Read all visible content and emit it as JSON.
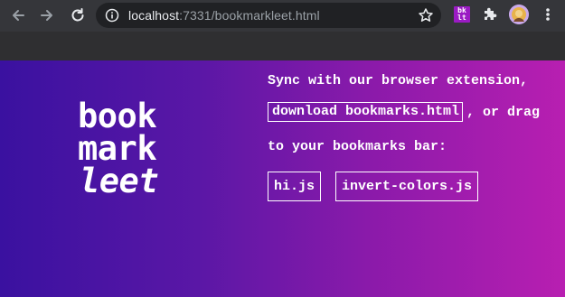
{
  "browser": {
    "url_host": "localhost",
    "url_rest": ":7331/bookmarkleet.html",
    "extension_badge_line1": "bk",
    "extension_badge_line2": "lt"
  },
  "logo": {
    "line1": "book",
    "line2": "mark",
    "line3": "leet"
  },
  "copy": {
    "line1": "Sync with our browser extension,",
    "download_link": "download bookmarks.html",
    "after_link": ", or drag",
    "line3": "to your bookmarks bar:"
  },
  "bookmarklets": [
    {
      "label": "hi.js"
    },
    {
      "label": "invert-colors.js"
    }
  ],
  "colors": {
    "gradient_start": "#3a11a0",
    "gradient_end": "#b81fb1",
    "toolbar": "#35363a",
    "omnibox": "#202124"
  }
}
